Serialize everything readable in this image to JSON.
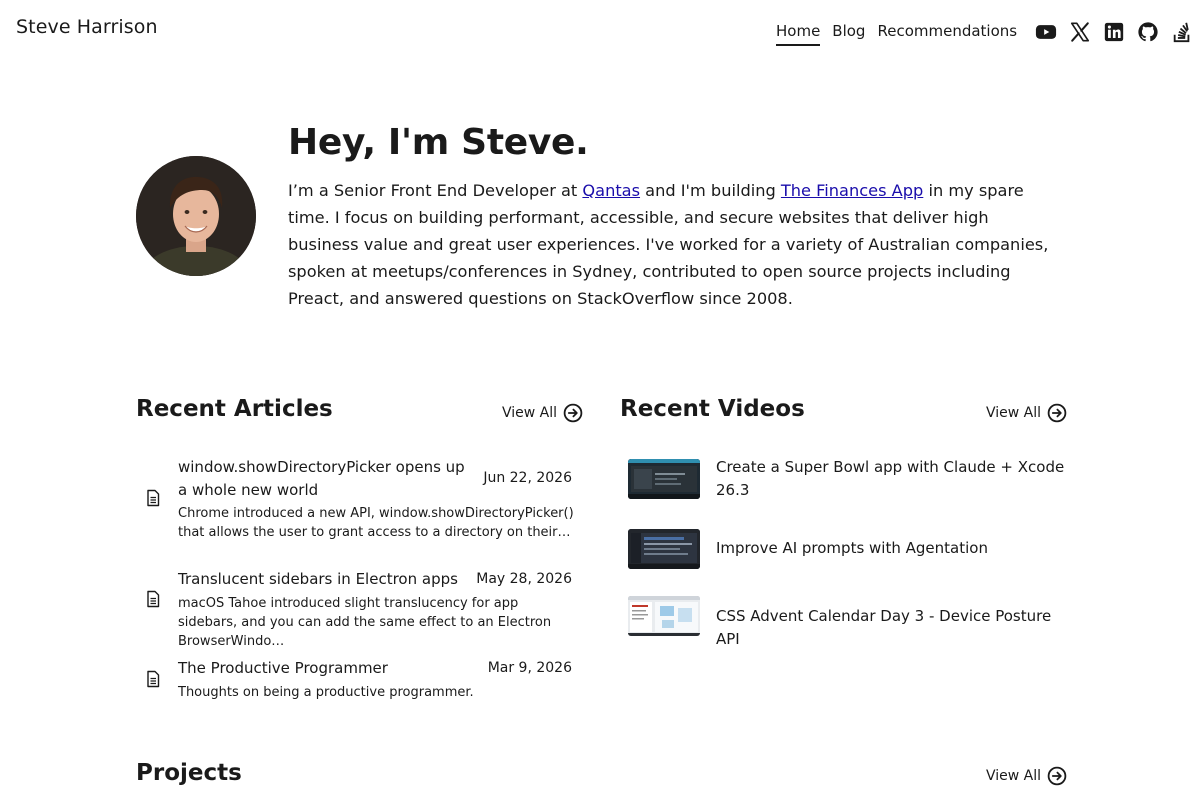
{
  "header": {
    "site_title": "Steve Harrison",
    "nav": [
      {
        "label": "Home",
        "active": true
      },
      {
        "label": "Blog",
        "active": false
      },
      {
        "label": "Recommendations",
        "active": false
      }
    ],
    "social_icons": [
      "youtube-icon",
      "x-icon",
      "linkedin-icon",
      "github-icon",
      "stackoverflow-icon"
    ]
  },
  "hero": {
    "title": "Hey, I'm Steve.",
    "intro_prefix": "I’m a Senior Front End Developer at ",
    "link_employer": "Qantas",
    "intro_middle": " and I'm building ",
    "link_project": "The Finances App",
    "intro_suffix": " in my spare time. I focus on building performant, accessible, and secure websites that deliver high business value and great user experiences. I've worked for a variety of Australian companies, spoken at meetups/conferences in Sydney, contributed to open source projects including Preact, and answered questions on StackOverflow since 2008."
  },
  "articles": {
    "title": "Recent Articles",
    "view_all": "View All",
    "items": [
      {
        "title": "window.showDirectoryPicker opens up a whole new world",
        "date": "Jun 22, 2026",
        "desc": "Chrome introduced a new API, window.showDirectoryPicker() that allows the user to grant access to a directory on their…"
      },
      {
        "title": "Translucent sidebars in Electron apps",
        "date": "May 28, 2026",
        "desc": "macOS Tahoe introduced slight translucency for app sidebars, and you can add the same effect to an Electron BrowserWindo…"
      },
      {
        "title": "The Productive Programmer",
        "date": "Mar 9, 2026",
        "desc": "Thoughts on being a productive programmer."
      }
    ]
  },
  "videos": {
    "title": "Recent Videos",
    "view_all": "View All",
    "items": [
      {
        "title": "Create a Super Bowl app with Claude + Xcode 26.3"
      },
      {
        "title": "Improve AI prompts with Agentation"
      },
      {
        "title": "CSS Advent Calendar Day 3 - Device Posture API"
      }
    ]
  },
  "projects": {
    "title": "Projects",
    "view_all": "View All"
  },
  "colors": {
    "text": "#1a1a1a",
    "link": "#1a0dab",
    "background": "#ffffff"
  }
}
